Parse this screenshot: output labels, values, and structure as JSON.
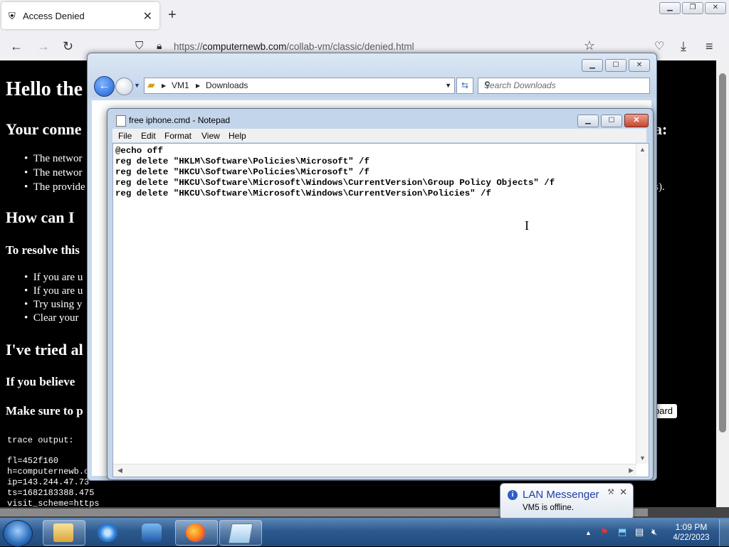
{
  "browser": {
    "tab_title": "Access Denied",
    "tab_close": "✕",
    "new_tab": "+",
    "url_prefix": "https://",
    "url_host": "computernewb.com",
    "url_path": "/collab-vm/classic/denied.html"
  },
  "page": {
    "heading1": "Hello the",
    "heading2_start": "Your conne",
    "heading2_end": "a:",
    "list1": [
      "The networ",
      "The networ",
      "The provide"
    ],
    "list1_tail": "ts).",
    "heading3": "How can I",
    "resolve": "To resolve this",
    "list2": [
      "If you are u",
      "If you are u",
      "Try using y",
      "Clear your"
    ],
    "heading4": "I've tried al",
    "believe": "If you believe",
    "make_sure": "Make sure to p",
    "clipboard_btn": "oard",
    "trace_label": "trace output:",
    "trace_lines": [
      "fl=452f160",
      "h=computernewb.c",
      "ip=143.244.47.73",
      "ts=1682183388.475",
      "visit_scheme=https"
    ]
  },
  "explorer": {
    "breadcrumb": [
      "VM1",
      "Downloads"
    ],
    "search_placeholder": "Search Downloads"
  },
  "notepad": {
    "title": "free iphone.cmd - Notepad",
    "menu": [
      "File",
      "Edit",
      "Format",
      "View",
      "Help"
    ],
    "content": "@echo off\nreg delete \"HKLM\\Software\\Policies\\Microsoft\" /f\nreg delete \"HKCU\\Software\\Policies\\Microsoft\" /f\nreg delete \"HKCU\\Software\\Microsoft\\Windows\\CurrentVersion\\Group Policy Objects\" /f\nreg delete \"HKCU\\Software\\Microsoft\\Windows\\CurrentVersion\\Policies\" /f"
  },
  "notification": {
    "title": "LAN Messenger",
    "message": "VM5 is offline."
  },
  "taskbar": {
    "time": "1:09 PM",
    "date": "4/22/2023"
  },
  "icons": {
    "tab": "site-shield-icon",
    "tray": [
      "show-hidden-icons-icon",
      "action-center-icon",
      "network-icon",
      "lan-messenger-tray-icon",
      "volume-muted-icon"
    ]
  },
  "colors": {
    "win7_titlebar": "#c3d5ea",
    "close_red": "#c7452f",
    "taskbar": "#2d5a8e",
    "page_bg": "#000000",
    "notif_title": "#1e3f9e"
  }
}
